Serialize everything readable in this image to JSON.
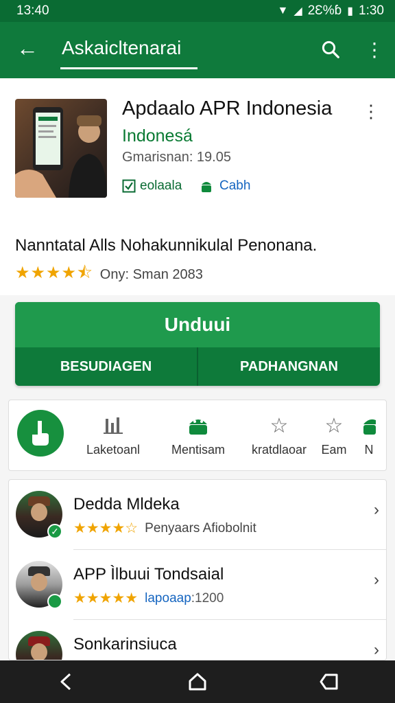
{
  "status_bar": {
    "time_left": "13:40",
    "battery": "2Ɛ%ɓ",
    "time_right": "1:30"
  },
  "app_bar": {
    "title": "Askaicltenarai"
  },
  "app": {
    "name": "Apdaalo APR Indonesia",
    "subtitle": "Indonesá",
    "meta": "Gmarisnan: 19.05",
    "tag1": "eolaala",
    "tag2": "Cabh"
  },
  "description": {
    "title": "Nanntatal Alls Nohakunnikulal Penonana.",
    "rating_text": "Ony: Sman 2083",
    "stars": "★★★★⯪"
  },
  "actions": {
    "install": "Unduui",
    "left": "BESUDIAGEN",
    "right": "PADHANGNAN"
  },
  "features": [
    {
      "label": "Laketoanl",
      "icon": "stats-icon"
    },
    {
      "label": "Mentisam",
      "icon": "android-icon"
    },
    {
      "label": "kratdlaoar",
      "icon": "star-icon"
    },
    {
      "label": "Eam",
      "icon": "star-icon"
    },
    {
      "label": "N",
      "icon": "android-icon"
    }
  ],
  "list": [
    {
      "title": "Dedda Mldeka",
      "stars": "★★★★☆",
      "sub": "Penyaars Afiobolnit"
    },
    {
      "title": "APP Ìlbuui Tondsaial",
      "stars": "★★★★★",
      "sub_blue": "lapoaap",
      "sub_rest": ":1200"
    },
    {
      "title": "Sonkarinsiuca"
    }
  ]
}
